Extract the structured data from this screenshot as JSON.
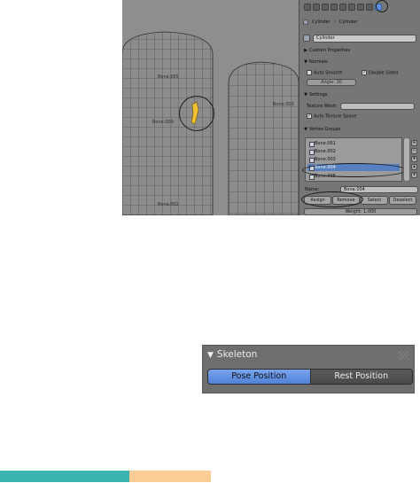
{
  "top_screenshot": {
    "viewport": {
      "bone_labels": [
        "Bone.005",
        "Bone.003",
        "Bone.009",
        "Bone.002"
      ]
    },
    "properties_panel": {
      "breadcrumb": {
        "object": "Cylinder",
        "mesh": "Cylinder"
      },
      "object_name": "Cylinder",
      "sections": {
        "custom_properties": "Custom Properties",
        "normals": "Normals",
        "settings": "Settings",
        "vertex_groups": "Vertex Groups"
      },
      "normals": {
        "auto_smooth": "Auto Smooth",
        "double_sided": "Double Sided",
        "angle": "Angle: 30"
      },
      "settings": {
        "texture_mesh_label": "Texture Mesh:",
        "auto_texture_space": "Auto Texture Space"
      },
      "vertex_group_items": [
        "Bone.001",
        "Bone.002",
        "Bone.003",
        "Bone.004",
        "Bone.005"
      ],
      "selected_group": "Bone.004",
      "name_label": "Name:",
      "name_value": "Bone.004",
      "buttons": {
        "assign": "Assign",
        "remove": "Remove",
        "select": "Select",
        "deselect": "Deselect"
      },
      "weight": "Weight: 1.000"
    }
  },
  "skeleton_panel": {
    "title": "Skeleton",
    "pose_position": "Pose Position",
    "rest_position": "Rest Position"
  },
  "colors": {
    "teal_bar": "#3bb3b1",
    "peach_bar": "#fbcc95",
    "selected_blue": "#5f8ee0"
  }
}
